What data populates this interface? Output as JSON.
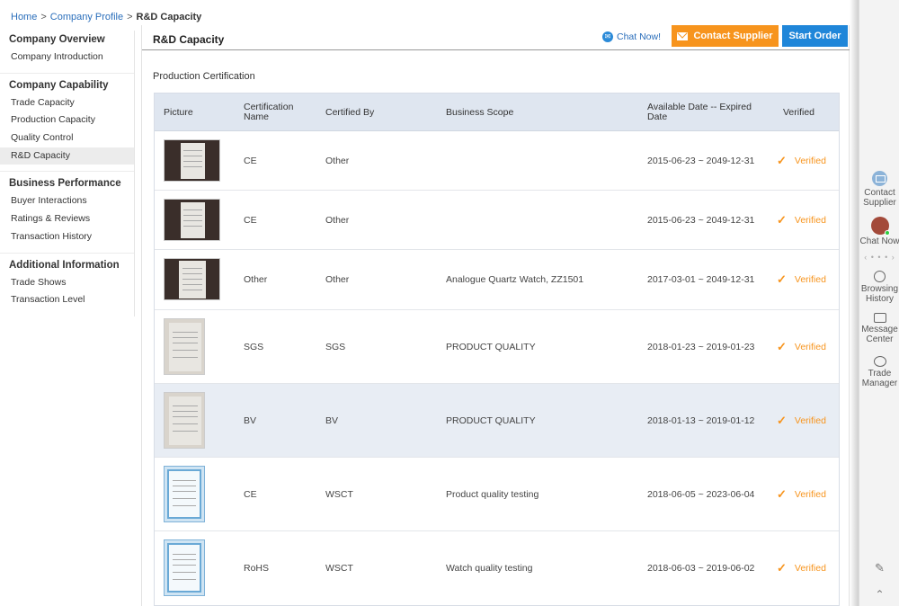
{
  "breadcrumb": {
    "home": "Home",
    "company_profile": "Company Profile",
    "current": "R&D Capacity",
    "separator": ">"
  },
  "sidebar": {
    "sections": [
      {
        "heading": "Company Overview",
        "items": [
          "Company Introduction"
        ]
      },
      {
        "heading": "Company Capability",
        "items": [
          "Trade Capacity",
          "Production Capacity",
          "Quality Control",
          "R&D Capacity"
        ]
      },
      {
        "heading": "Business Performance",
        "items": [
          "Buyer Interactions",
          "Ratings & Reviews",
          "Transaction History"
        ]
      },
      {
        "heading": "Additional Information",
        "items": [
          "Trade Shows",
          "Transaction Level"
        ]
      }
    ],
    "active_item": "R&D Capacity"
  },
  "main": {
    "title": "R&D Capacity",
    "chat_now": "Chat Now!",
    "contact_supplier": "Contact Supplier",
    "start_order": "Start Order",
    "section_title": "Production Certification"
  },
  "table": {
    "headers": {
      "picture": "Picture",
      "certification_name": "Certification Name",
      "certified_by": "Certified By",
      "business_scope": "Business Scope",
      "date_range": "Available Date -- Expired Date",
      "verified": "Verified"
    },
    "rows": [
      {
        "name": "CE",
        "by": "Other",
        "scope": "",
        "dates": "2015-06-23 ~ 2049-12-31",
        "verified": "Verified"
      },
      {
        "name": "CE",
        "by": "Other",
        "scope": "",
        "dates": "2015-06-23 ~ 2049-12-31",
        "verified": "Verified"
      },
      {
        "name": "Other",
        "by": "Other",
        "scope": "Analogue Quartz Watch, ZZ1501",
        "dates": "2017-03-01 ~ 2049-12-31",
        "verified": "Verified"
      },
      {
        "name": "SGS",
        "by": "SGS",
        "scope": "PRODUCT QUALITY",
        "dates": "2018-01-23 ~ 2019-01-23",
        "verified": "Verified"
      },
      {
        "name": "BV",
        "by": "BV",
        "scope": "PRODUCT QUALITY",
        "dates": "2018-01-13 ~ 2019-01-12",
        "verified": "Verified"
      },
      {
        "name": "CE",
        "by": "WSCT",
        "scope": "Product quality testing",
        "dates": "2018-06-05 ~ 2023-06-04",
        "verified": "Verified"
      },
      {
        "name": "RoHS",
        "by": "WSCT",
        "scope": "Watch quality testing",
        "dates": "2018-06-03 ~ 2019-06-02",
        "verified": "Verified"
      }
    ]
  },
  "right_bar": {
    "contact_supplier": "Contact Supplier",
    "chat_now": "Chat Now",
    "browsing_history": "Browsing History",
    "message_center": "Message Center",
    "trade_manager": "Trade Manager"
  },
  "colors": {
    "accent_orange": "#f7941d",
    "primary_blue": "#1f86d9",
    "link_blue": "#2a6ebb",
    "table_header": "#dfe6f0"
  }
}
